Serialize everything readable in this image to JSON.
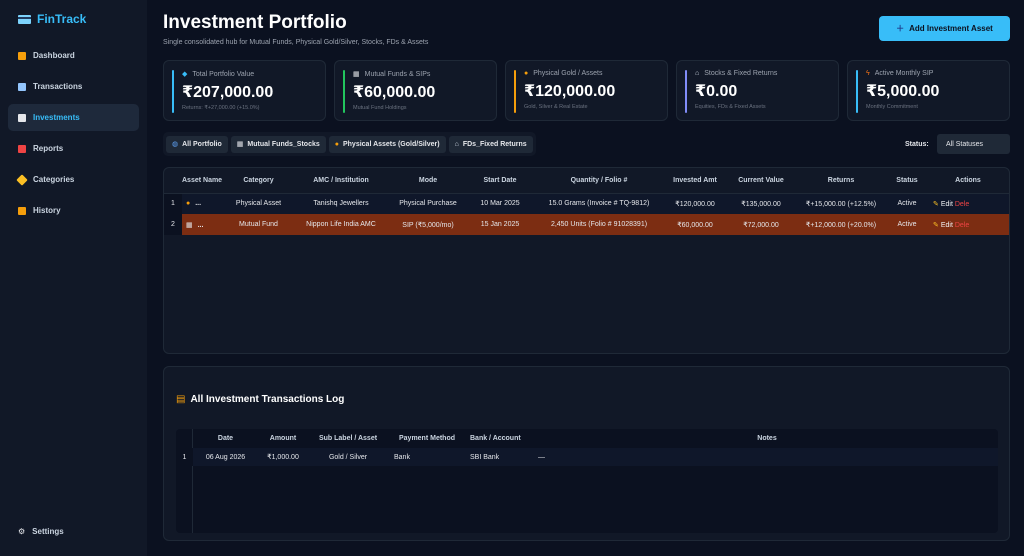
{
  "app": {
    "name": "FinTrack"
  },
  "sidebar": {
    "items": [
      {
        "label": "Dashboard",
        "icon": "house-icon",
        "color": "#f59e0b"
      },
      {
        "label": "Transactions",
        "icon": "card-icon",
        "color": "#93c5fd"
      },
      {
        "label": "Investments",
        "icon": "trend-chart-icon",
        "color": "#e5e7eb",
        "active": true
      },
      {
        "label": "Reports",
        "icon": "bar-chart-icon",
        "color": "#ef4444"
      },
      {
        "label": "Categories",
        "icon": "tag-icon",
        "color": "#fbbf24"
      },
      {
        "label": "History",
        "icon": "scroll-icon",
        "color": "#f59e0b"
      }
    ],
    "settings_label": "Settings"
  },
  "header": {
    "title": "Investment Portfolio",
    "subtitle": "Single consolidated hub for Mutual Funds, Physical Gold/Silver, Stocks, FDs & Assets",
    "add_button": "Add Investment Asset"
  },
  "cards": [
    {
      "label": "Total Portfolio Value",
      "value": "₹207,000.00",
      "sub": "Returns: ₹+27,000.00 (+15.0%)",
      "color": "#38bdf8",
      "icon": "diamond-icon"
    },
    {
      "label": "Mutual Funds & SIPs",
      "value": "₹60,000.00",
      "sub": "Mutual Fund Holdings",
      "color": "#22c55e",
      "icon": "trend-chart-icon"
    },
    {
      "label": "Physical Gold / Assets",
      "value": "₹120,000.00",
      "sub": "Gold, Silver & Real Estate",
      "color": "#f59e0b",
      "icon": "coin-icon"
    },
    {
      "label": "Stocks & Fixed Returns",
      "value": "₹0.00",
      "sub": "Equities, FDs & Fixed Assets",
      "color": "#818cf8",
      "icon": "bank-icon"
    },
    {
      "label": "Active Monthly SIP",
      "value": "₹5,000.00",
      "sub": "Monthly Commitment",
      "color": "#38bdf8",
      "icon": "lightning-icon"
    }
  ],
  "tabs": [
    {
      "label": "All Portfolio",
      "icon": "globe-icon"
    },
    {
      "label": "Mutual Funds_Stocks",
      "icon": "trend-chart-icon"
    },
    {
      "label": "Physical Assets (Gold/Silver)",
      "icon": "coin-icon"
    },
    {
      "label": "FDs_Fixed Returns",
      "icon": "bank-icon"
    }
  ],
  "status_filter": {
    "label": "Status:",
    "value": "All Statuses"
  },
  "investments": {
    "headers": [
      "",
      "Asset Name",
      "Category",
      "AMC / Institution",
      "Mode",
      "Start Date",
      "Quantity / Folio #",
      "Invested Amt",
      "Current Value",
      "Returns",
      "Status",
      "Actions"
    ],
    "rows": [
      {
        "idx": "1",
        "icon": "coin-icon",
        "name": "...",
        "category": "Physical Asset",
        "amc": "Tanishq Jewellers",
        "mode": "Physical Purchase",
        "start": "10 Mar 2025",
        "qty": "15.0 Grams (Invoice # TQ-9812)",
        "invested": "₹120,000.00",
        "current": "₹135,000.00",
        "returns": "₹+15,000.00 (+12.5%)",
        "status": "Active",
        "edit": "Edit",
        "del": "Dele"
      },
      {
        "idx": "2",
        "icon": "trend-chart-icon",
        "name": "...",
        "category": "Mutual Fund",
        "amc": "Nippon Life India AMC",
        "mode": "SIP (₹5,000/mo)",
        "start": "15 Jan 2025",
        "qty": "2,450 Units (Folio # 91028391)",
        "invested": "₹60,000.00",
        "current": "₹72,000.00",
        "returns": "₹+12,000.00 (+20.0%)",
        "status": "Active",
        "edit": "Edit",
        "del": "Dele"
      }
    ]
  },
  "log": {
    "title": "All Investment Transactions Log",
    "headers": [
      "",
      "Date",
      "Amount",
      "Sub Label / Asset",
      "Payment Method",
      "Bank / Account",
      "Notes"
    ],
    "rows": [
      {
        "idx": "1",
        "date": "06 Aug 2026",
        "amount": "₹1,000.00",
        "asset": "Gold / Silver",
        "method": "Bank",
        "bank": "SBI Bank",
        "notes": "—"
      }
    ]
  }
}
